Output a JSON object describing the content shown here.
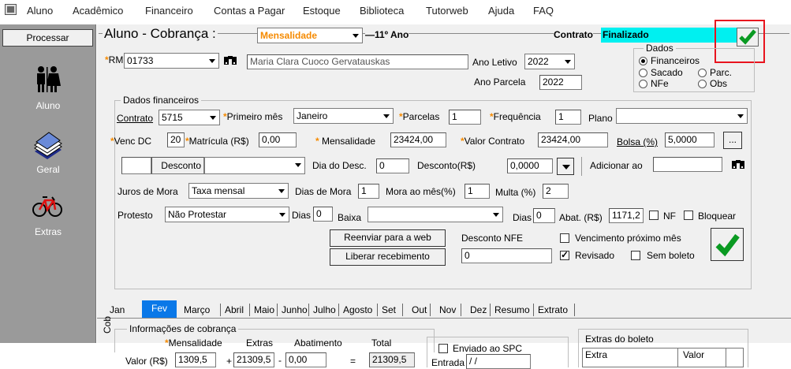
{
  "menu": [
    "Aluno",
    "Acadêmico",
    "Financeiro",
    "Contas a Pagar",
    "Estoque",
    "Biblioteca",
    "Tutorweb",
    "Ajuda",
    "FAQ"
  ],
  "sidebar": {
    "process_button": "Processar",
    "items": [
      {
        "label": "Aluno",
        "icon": "people-icon"
      },
      {
        "label": "Geral",
        "icon": "document-stack-icon"
      },
      {
        "label": "Extras",
        "icon": "bicycle-icon"
      }
    ]
  },
  "header": {
    "title": "Aluno - Cobrança :",
    "type_value": "Mensalidade",
    "series": "11º Ano",
    "contrato_label": "Contrato",
    "contrato_status": "Finalizado"
  },
  "colors": {
    "status_bg": "#00f0f0",
    "accent": "#0a78e8",
    "orange": "#f58a00",
    "highlight_red": "#e8141e"
  },
  "student": {
    "rm_label": "RM",
    "rm_value": "01733",
    "name": "Maria Clara Cuoco Gervatauskas",
    "ano_letivo_label": "Ano Letivo",
    "ano_letivo_value": "2022",
    "ano_parcela_label": "Ano Parcela",
    "ano_parcela_value": "2022"
  },
  "dados": {
    "title": "Dados",
    "options": [
      "Financeiros",
      "Sacado",
      "Parc.",
      "NFe",
      "Obs"
    ]
  },
  "fin": {
    "group_title": "Dados financeiros",
    "contrato_label": "Contrato",
    "contrato_value": "5715",
    "primeiro_mes_label": "Primeiro mês",
    "primeiro_mes_value": "Janeiro",
    "parcelas_label": "Parcelas",
    "parcelas_value": "1",
    "frequencia_label": "Frequência",
    "frequencia_value": "1",
    "plano_label": "Plano",
    "plano_value": "",
    "venc_label": "Venc DC",
    "venc_value": "20",
    "matricula_label": "Matrícula (R$)",
    "matricula_value": "0,00",
    "mensalidade_label": "Mensalidade",
    "mensalidade_value": "23424,00",
    "valor_contrato_label": "Valor Contrato",
    "valor_contrato_value": "23424,00",
    "bolsa_label": "Bolsa (%)",
    "bolsa_value": "5,0000",
    "bolsa_btn": "...",
    "desconto_label": "Desconto",
    "dia_desc_label": "Dia do Desc.",
    "dia_desc_value": "0",
    "desconto_rs_label": "Desconto(R$)",
    "desconto_rs_value": "0,0000",
    "adicionar_label": "Adicionar ao",
    "juros_label": "Juros de Mora",
    "juros_value": "Taxa mensal",
    "dias_mora_label": "Dias de Mora",
    "dias_mora_value": "1",
    "mora_mes_label": "Mora ao mês(%)",
    "mora_mes_value": "1",
    "multa_label": "Multa (%)",
    "multa_value": "2",
    "protesto_label": "Protesto",
    "protesto_value": "Não Protestar",
    "dias_label": "Dias",
    "dias_value": "0",
    "baixa_label": "Baixa",
    "baixa_dias_label": "Dias",
    "baixa_dias_value": "0",
    "abat_label": "Abat. (R$)",
    "abat_value": "1171,2",
    "nf_label": "NF",
    "bloquear_label": "Bloquear"
  },
  "actions": {
    "reenviar": "Reenviar para a web",
    "liberar": "Liberar recebimento",
    "desconto_nfe_label": "Desconto NFE",
    "desconto_nfe_value": "0",
    "venc_proximo_label": "Vencimento próximo mês",
    "revisado_label": "Revisado",
    "sem_boleto_label": "Sem boleto"
  },
  "tabs": [
    "Jan",
    "Fev",
    "Março",
    "Abril",
    "Maio",
    "Junho",
    "Julho",
    "Agosto",
    "Set",
    "Out",
    "Nov",
    "Dez",
    "Resumo",
    "Extrato"
  ],
  "cobranca": {
    "side_label": "Cob",
    "group_title": "Informações de cobrança",
    "col_mensalidade": "Mensalidade",
    "col_extras": "Extras",
    "col_abatimento": "Abatimento",
    "col_total": "Total",
    "row_label": "Valor (R$)",
    "mensalidade": "1309,5",
    "extras": "21309,5",
    "abatimento": "0,00",
    "total": "21309,5",
    "op_plus": "+",
    "op_minus": "-",
    "op_eq": "=",
    "spc_label": "Enviado ao SPC",
    "entrada_label": "Entrada",
    "entrada_value": "/ /",
    "extras_boleto_title": "Extras do boleto",
    "col_extra": "Extra",
    "col_valor": "Valor"
  }
}
